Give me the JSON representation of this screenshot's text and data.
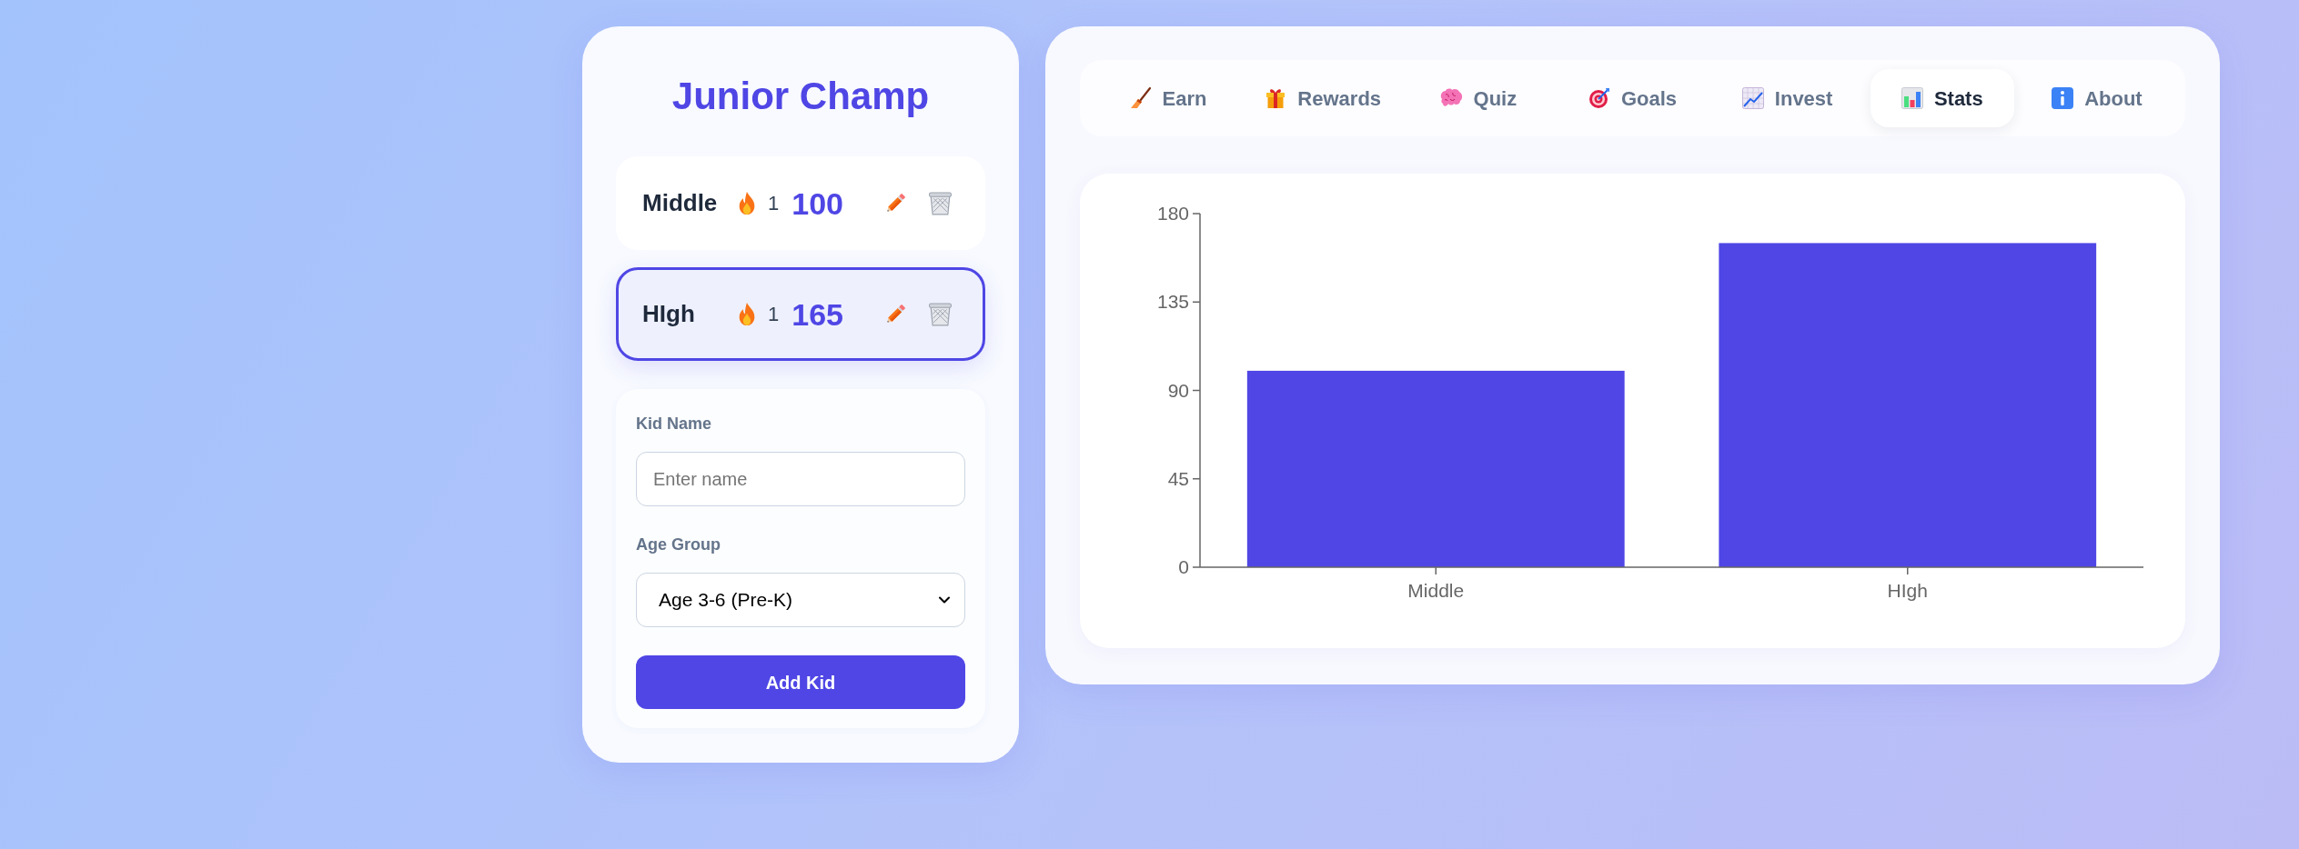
{
  "app": {
    "title": "Junior Champ"
  },
  "kids": [
    {
      "name": "Middle",
      "streak": "1",
      "points": "100",
      "selected": false
    },
    {
      "name": "HIgh",
      "streak": "1",
      "points": "165",
      "selected": true
    }
  ],
  "add_kid_form": {
    "name_label": "Kid Name",
    "name_field": {
      "placeholder": "Enter name"
    },
    "age_label": "Age Group",
    "age_select": {
      "value": "Age 3-6 (Pre-K)"
    },
    "submit_button": "Add Kid"
  },
  "tabs": [
    {
      "label": "Earn",
      "selected": false
    },
    {
      "label": "Rewards",
      "selected": false
    },
    {
      "label": "Quiz",
      "selected": false
    },
    {
      "label": "Goals",
      "selected": false
    },
    {
      "label": "Invest",
      "selected": false
    },
    {
      "label": "Stats",
      "selected": true
    },
    {
      "label": "About",
      "selected": false
    }
  ],
  "stats_panel": {
    "chart_data": {
      "type": "bar",
      "categories": [
        "Middle",
        "HIgh"
      ],
      "values": [
        100,
        165
      ],
      "ylim": [
        0,
        180
      ],
      "yticks": [
        0,
        45,
        90,
        135,
        180
      ]
    }
  }
}
